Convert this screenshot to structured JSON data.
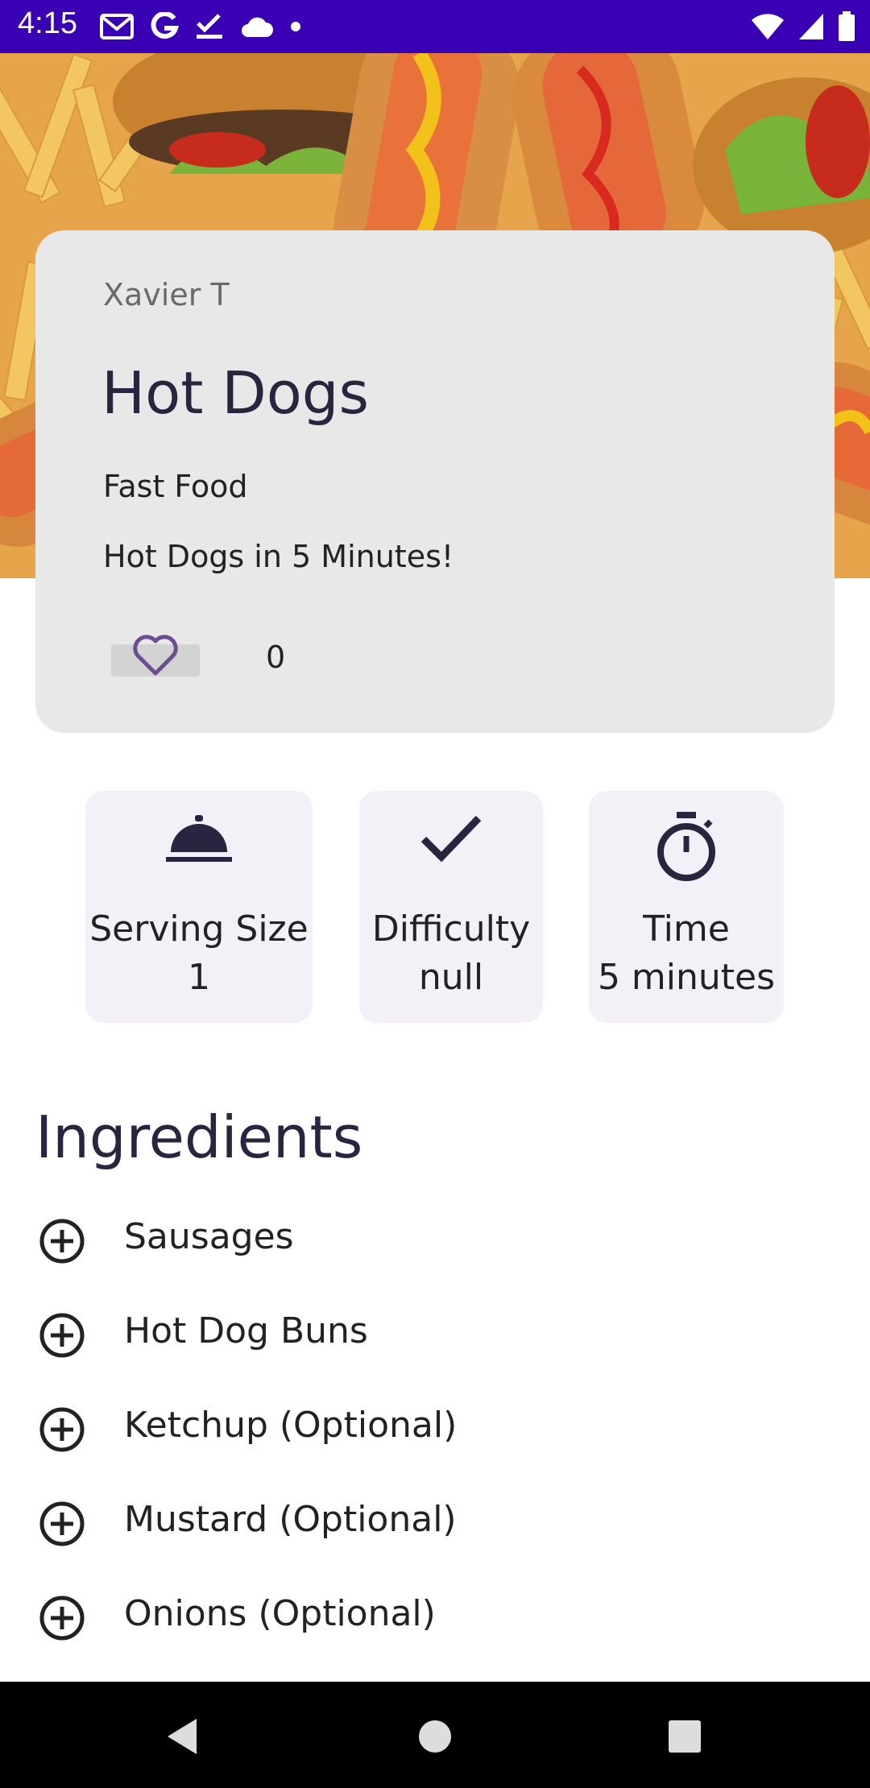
{
  "status_bar": {
    "time": "4:15",
    "left_icons": [
      "gmail-icon",
      "google-icon",
      "task-check-icon",
      "cloud-icon",
      "dot-icon"
    ],
    "right_icons": [
      "wifi-icon",
      "signal-icon",
      "battery-icon"
    ],
    "background": "#3a00b4"
  },
  "hero": {
    "image": "hot-dogs-and-fries-photo"
  },
  "recipe": {
    "author": "Xavier T",
    "title": "Hot Dogs",
    "category": "Fast Food",
    "subtitle": "Hot Dogs in 5 Minutes!",
    "like_count": "0"
  },
  "stats": {
    "serving": {
      "label": "Serving Size",
      "value": "1",
      "icon": "cloche-icon"
    },
    "difficulty": {
      "label": "Difficulty",
      "value": "null",
      "icon": "check-icon"
    },
    "time": {
      "label": "Time",
      "value": "5 minutes",
      "icon": "stopwatch-icon"
    }
  },
  "ingredients": {
    "heading": "Ingredients",
    "items": [
      {
        "label": "Sausages"
      },
      {
        "label": "Hot Dog Buns"
      },
      {
        "label": "Ketchup (Optional)"
      },
      {
        "label": "Mustard (Optional)"
      },
      {
        "label": "Onions (Optional)"
      }
    ]
  },
  "nav_bar": {
    "buttons": [
      "back-icon",
      "home-icon",
      "recents-icon"
    ]
  },
  "colors": {
    "accent": "#3a00b4",
    "title_text": "#2b2440",
    "card_bg": "#e8e8e8",
    "tile_bg": "#f3f0f7",
    "heart": "#6b4e8f"
  }
}
